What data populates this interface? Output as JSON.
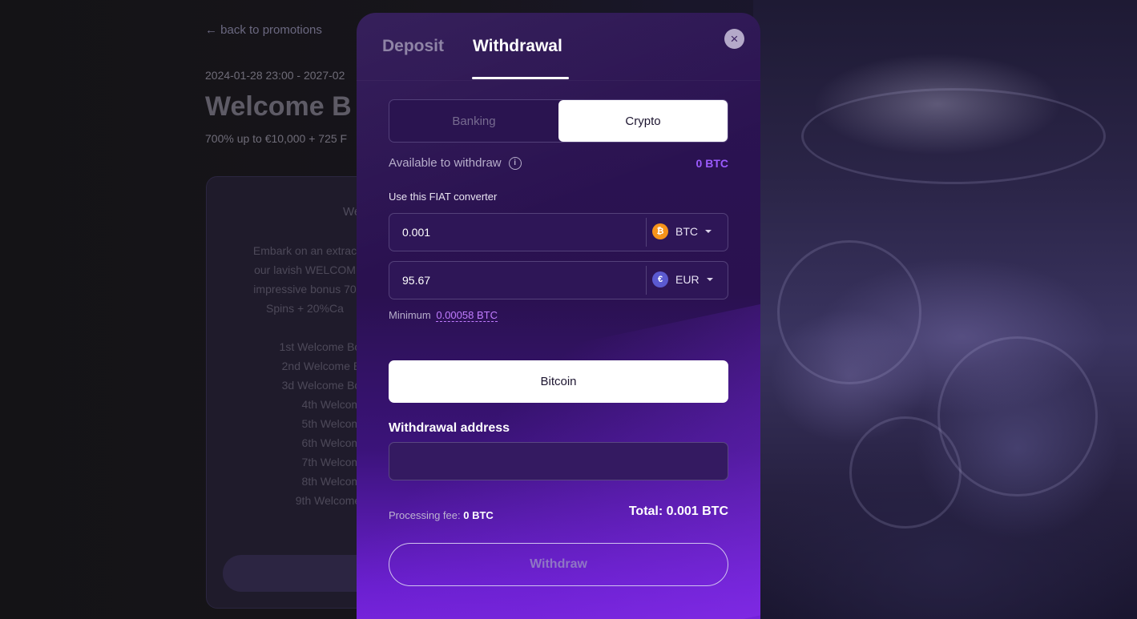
{
  "background": {
    "back_link": "← back to promotions",
    "date_range": "2024-01-28 23:00 - 2027-02",
    "title": "Welcome B",
    "subtitle": "700% up to €10,000 + 725 F",
    "card_heading": "We",
    "card_text": [
      "Embark on an extrac",
      "our lavish WELCOM",
      "impressive bonus 70",
      "Spins + 20%Ca"
    ],
    "card_list": [
      "1st Welcome Bon",
      "2nd Welcome Bo",
      "3d Welcome Bon",
      "4th Welcome",
      "5th Welcome",
      "6th Welcome",
      "7th Welcome",
      "8th Welcome",
      "9th Welcome I"
    ]
  },
  "modal": {
    "tabs": {
      "deposit": "Deposit",
      "withdrawal": "Withdrawal"
    },
    "close_icon": "×",
    "segment": {
      "banking": "Banking",
      "crypto": "Crypto"
    },
    "available_label": "Available to withdraw",
    "available_value": "0 BTC",
    "fiat_label": "Use this FIAT converter",
    "crypto_amount": "0.001",
    "crypto_currency": "BTC",
    "crypto_symbol": "₿",
    "fiat_amount": "95.67",
    "fiat_currency": "EUR",
    "fiat_symbol": "€",
    "minimum_label": "Minimum",
    "minimum_value": "0.00058 BTC",
    "method": "Bitcoin",
    "address_label": "Withdrawal address",
    "address_value": "",
    "fee_label": "Processing fee:",
    "fee_value": "0 BTC",
    "total": "Total: 0.001 BTC",
    "withdraw_button": "Withdraw",
    "colors": {
      "accent": "#9b5bff",
      "btc": "#f7931a",
      "eur": "#5b5ad0"
    }
  }
}
